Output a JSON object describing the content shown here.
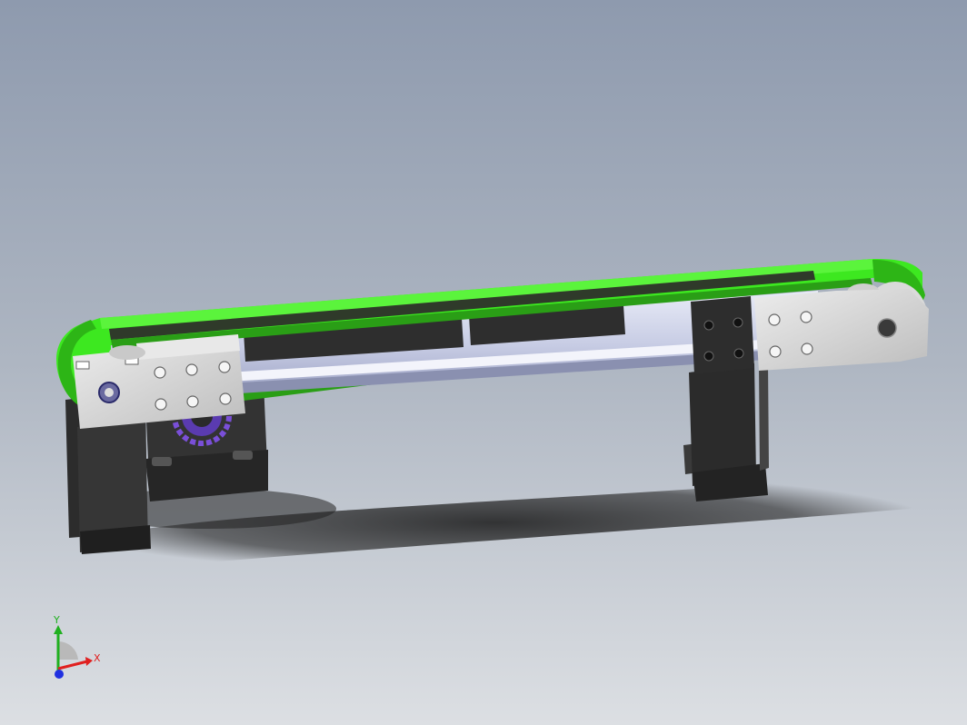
{
  "viewport": {
    "background_top": "#8e9aae",
    "background_bottom": "#dcdfe3"
  },
  "model": {
    "belt_color": "#3de820",
    "belt_dark": "#2a9e16",
    "plate_color": "#d8d8d8",
    "frame_color": "#2b2b2b",
    "rail_color": "#cfd3e8",
    "sprocket_color": "#7a4fd8"
  },
  "triad": {
    "x_label": "X",
    "y_label": "Y",
    "x_color": "#e02020",
    "y_color": "#20b020",
    "z_color": "#2030e0"
  }
}
